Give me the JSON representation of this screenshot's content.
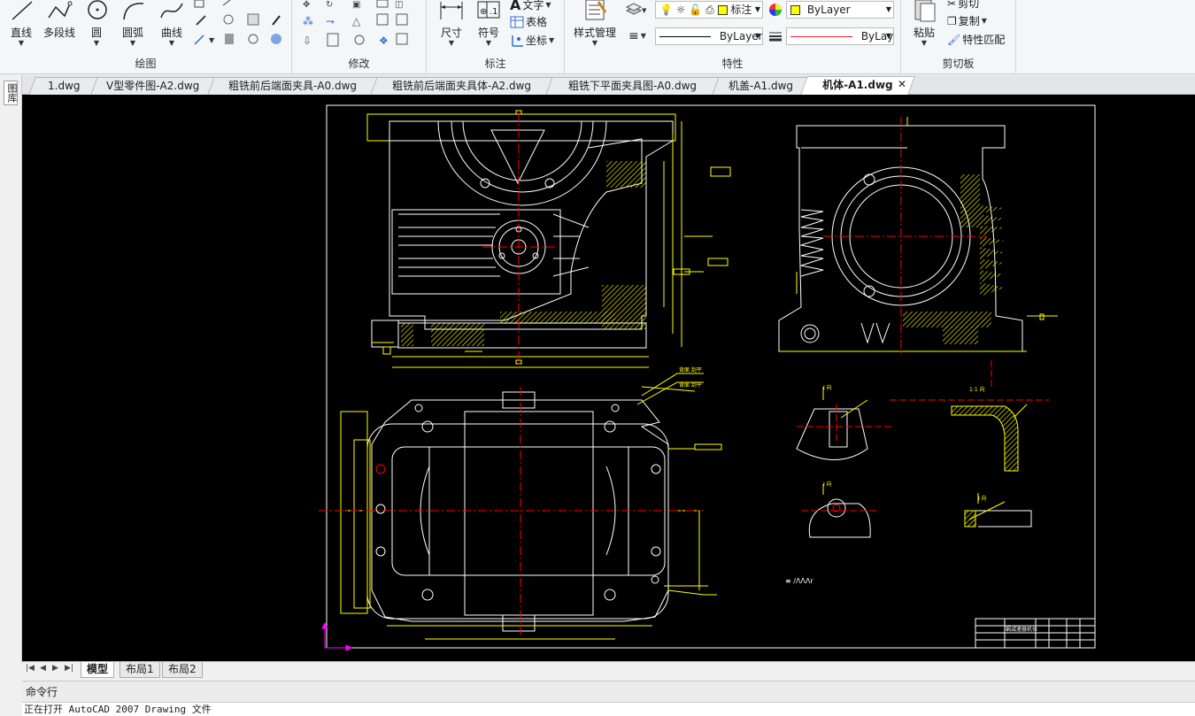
{
  "ribbon": {
    "draw_panel": {
      "title": "绘图",
      "line": "直线",
      "polyline": "多段线",
      "circle": "圆",
      "arc": "圆弧",
      "spline": "曲线"
    },
    "modify_panel": {
      "title": "修改"
    },
    "annotation_panel": {
      "title": "标注",
      "dimension": "尺寸",
      "symbol": "符号",
      "text": "文字",
      "table": "表格",
      "coordinate": "坐标"
    },
    "properties_panel": {
      "title": "特性",
      "style_manage": "样式管理",
      "layer_value": "标注",
      "color_value": "ByLayer",
      "linetype_value": "ByLayer",
      "lineweight_value": "ByLayer"
    },
    "clipboard_panel": {
      "title": "剪切板",
      "paste": "粘贴",
      "cut": "剪切",
      "copy": "复制",
      "match": "特性匹配"
    }
  },
  "tabs": [
    {
      "label": "1.dwg"
    },
    {
      "label": "V型零件图-A2.dwg"
    },
    {
      "label": "粗铣前后端面夹具-A0.dwg"
    },
    {
      "label": "粗铣前后端面夹具体-A2.dwg"
    },
    {
      "label": "粗铣下平面夹具图-A0.dwg"
    },
    {
      "label": "机盖-A1.dwg"
    },
    {
      "label": "机体-A1.dwg"
    }
  ],
  "active_tab_index": 6,
  "left_strip_label": "图库",
  "layout_tabs": [
    "模型",
    "布局1",
    "布局2"
  ],
  "title_block_text": "蜗减速器机体",
  "cmd": {
    "title": "命令行",
    "text": "正在打开 AutoCAD 2007 Drawing 文件"
  },
  "colors": {
    "canvas_bg": "#000000",
    "geometry": "#ffffff",
    "dimension": "#ffff00",
    "centerline": "#ff0000",
    "ucs": "#ff00ff",
    "ribbon_bg": "#f5f6f7"
  }
}
